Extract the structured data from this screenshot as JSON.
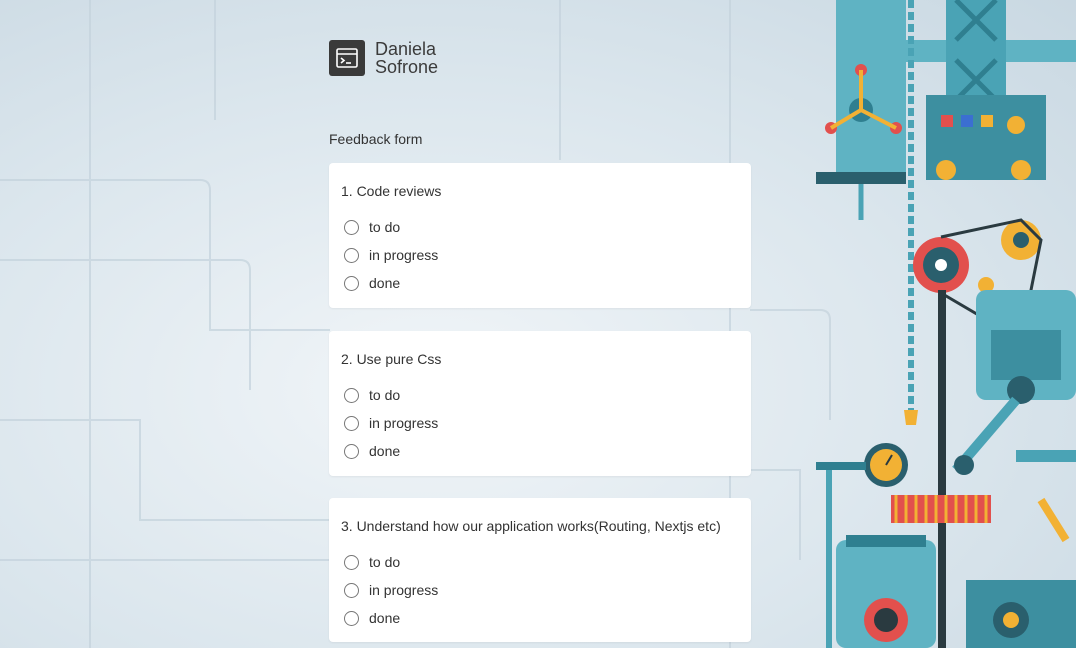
{
  "brand": {
    "first": "Daniela",
    "last": "Sofrone",
    "logo_icon": "terminal-icon"
  },
  "form": {
    "title": "Feedback form",
    "questions": [
      {
        "label": "1. Code reviews",
        "options": [
          "to do",
          "in progress",
          "done"
        ]
      },
      {
        "label": "2. Use pure Css",
        "options": [
          "to do",
          "in progress",
          "done"
        ]
      },
      {
        "label": "3. Understand how our application works(Routing, Nextjs etc)",
        "options": [
          "to do",
          "in progress",
          "done"
        ]
      }
    ]
  },
  "colors": {
    "card": "#ffffff",
    "logo_bg": "#3a3a3a",
    "machine_teal": "#4aa3b5",
    "machine_red": "#e2504d"
  }
}
